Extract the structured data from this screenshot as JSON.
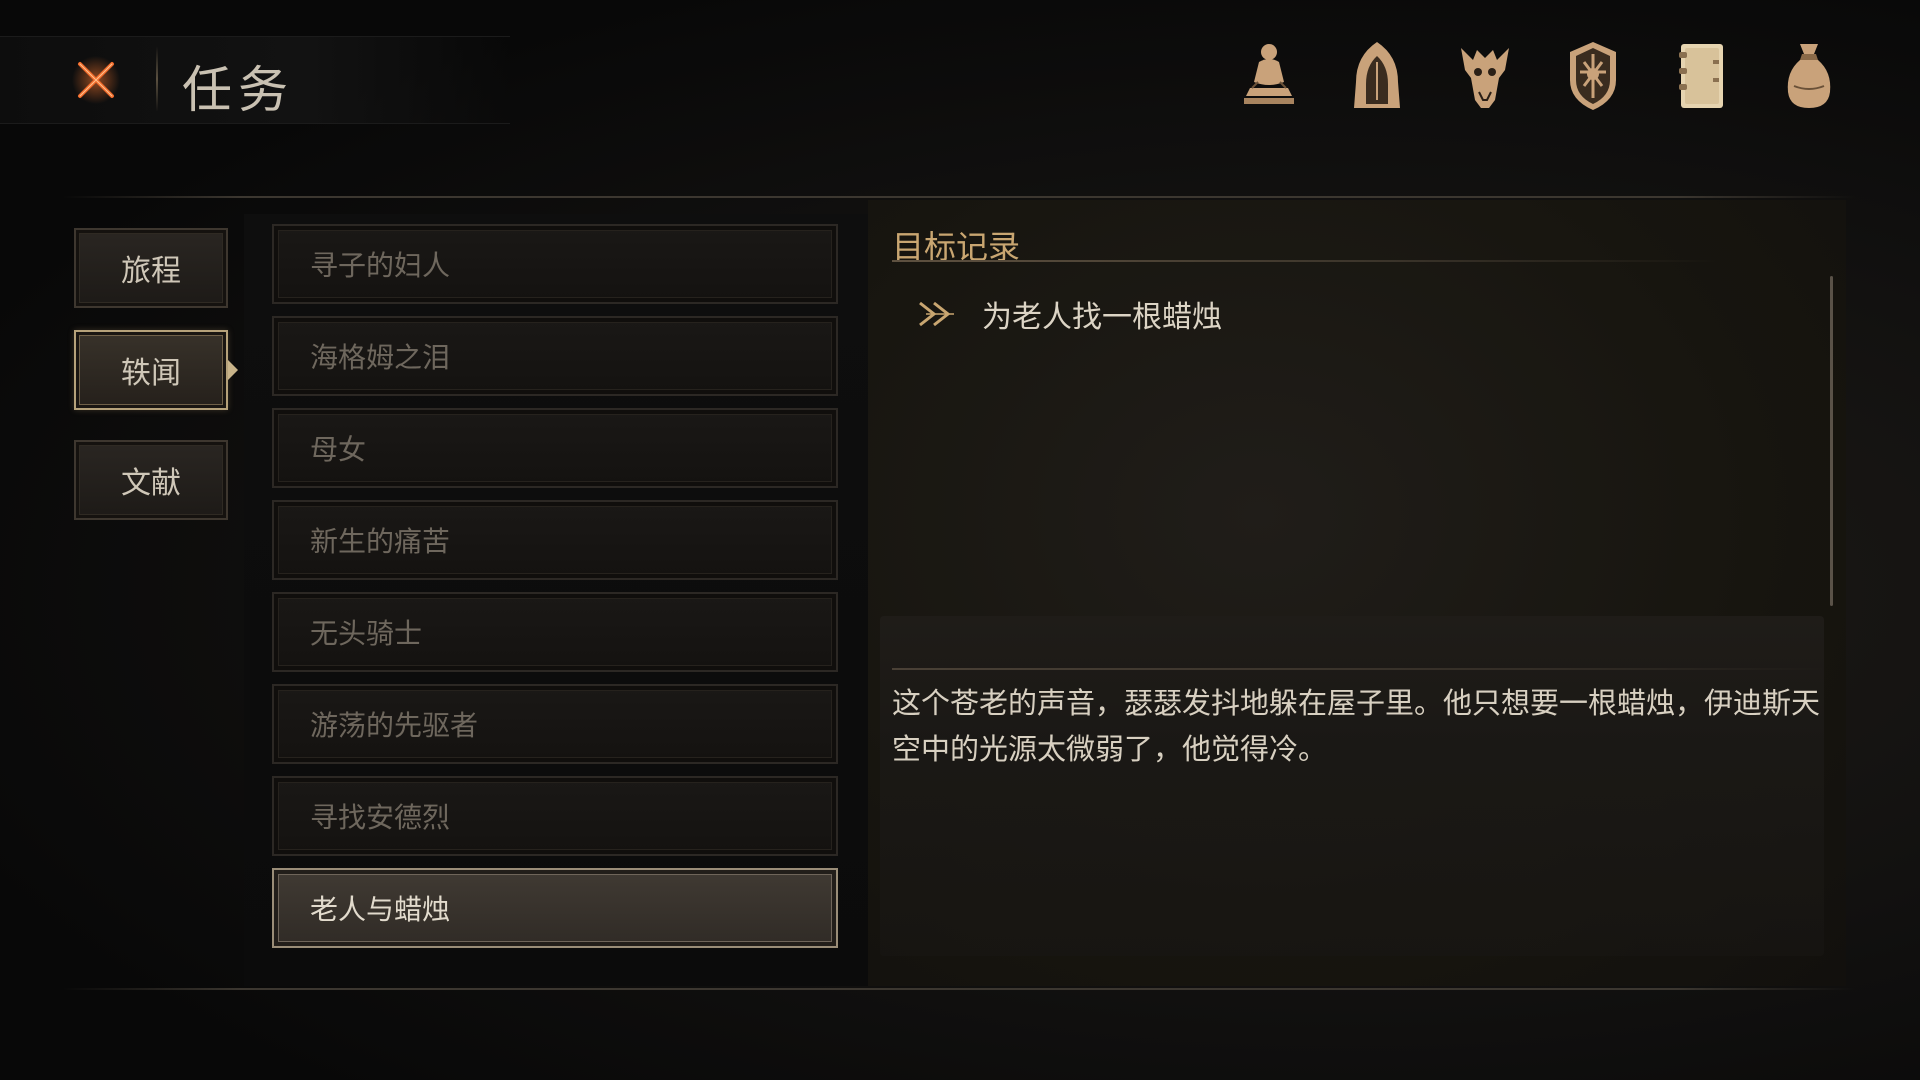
{
  "header": {
    "title": "任务",
    "close_icon": "close-x-icon",
    "icons": [
      {
        "name": "character-statue-icon"
      },
      {
        "name": "hooded-figure-icon"
      },
      {
        "name": "beast-skull-icon"
      },
      {
        "name": "faction-crest-icon"
      },
      {
        "name": "journal-book-icon"
      },
      {
        "name": "item-bag-icon"
      }
    ]
  },
  "categories": [
    {
      "label": "旅程",
      "active": false
    },
    {
      "label": "轶闻",
      "active": true
    },
    {
      "label": "文献",
      "active": false
    }
  ],
  "quests": [
    {
      "label": "寻子的妇人",
      "selected": false
    },
    {
      "label": "海格姆之泪",
      "selected": false
    },
    {
      "label": "母女",
      "selected": false
    },
    {
      "label": "新生的痛苦",
      "selected": false
    },
    {
      "label": "无头骑士",
      "selected": false
    },
    {
      "label": "游荡的先驱者",
      "selected": false
    },
    {
      "label": "寻找安德烈",
      "selected": false
    },
    {
      "label": "老人与蜡烛",
      "selected": true
    }
  ],
  "details": {
    "section_title": "目标记录",
    "objective": "为老人找一根蜡烛",
    "objective_icon": "double-chevron-icon",
    "description": "这个苍老的声音，瑟瑟发抖地躲在屋子里。他只想要一根蜡烛，伊迪斯天空中的光源太微弱了，他觉得冷。"
  },
  "colors": {
    "accent_gold": "#c9a671",
    "close_orange": "#e8632a",
    "icon_tan": "#c9a27a"
  }
}
